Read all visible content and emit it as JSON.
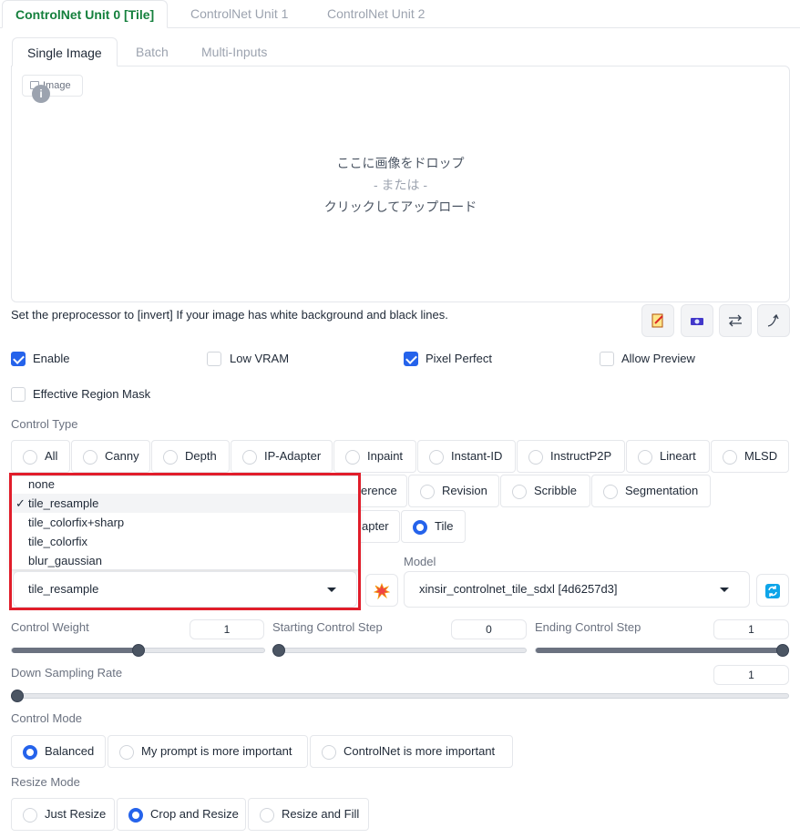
{
  "unit_tabs": [
    "ControlNet Unit 0 [Tile]",
    "ControlNet Unit 1",
    "ControlNet Unit 2"
  ],
  "sub_tabs": [
    "Single Image",
    "Batch",
    "Multi-Inputs"
  ],
  "image_label": "Image",
  "drop_text": {
    "line1": "ここに画像をドロップ",
    "line2": "- または -",
    "line3": "クリックしてアップロード"
  },
  "hint": "Set the preprocessor to [invert] If your image has white background and black lines.",
  "tool_icons": [
    "edit-icon",
    "camera-icon",
    "swap-icon",
    "curve-arrow-icon"
  ],
  "checkboxes": {
    "enable": {
      "label": "Enable",
      "checked": true
    },
    "low_vram": {
      "label": "Low VRAM",
      "checked": false
    },
    "pixel_perfect": {
      "label": "Pixel Perfect",
      "checked": true
    },
    "allow_preview": {
      "label": "Allow Preview",
      "checked": false
    },
    "effective_region_mask": {
      "label": "Effective Region Mask",
      "checked": false
    }
  },
  "control_type": {
    "label": "Control Type",
    "row1": [
      "All",
      "Canny",
      "Depth",
      "IP-Adapter",
      "Inpaint",
      "Instant-ID",
      "InstructP2P",
      "Lineart",
      "MLSD"
    ],
    "row2_visible": [
      "erence",
      "Revision",
      "Scribble",
      "Segmentation"
    ],
    "row3_visible": [
      "apter",
      "Tile"
    ],
    "selected": "Tile"
  },
  "preprocessor": {
    "options": [
      "none",
      "tile_resample",
      "tile_colorfix+sharp",
      "tile_colorfix",
      "blur_gaussian"
    ],
    "value": "tile_resample",
    "check_mark": "✓"
  },
  "model": {
    "label": "Model",
    "value": "xinsir_controlnet_tile_sdxl [4d6257d3]"
  },
  "sliders": {
    "control_weight": {
      "label": "Control Weight",
      "value": "1",
      "fraction": 0.5
    },
    "starting_step": {
      "label": "Starting Control Step",
      "value": "0",
      "fraction": 0.0
    },
    "ending_step": {
      "label": "Ending Control Step",
      "value": "1",
      "fraction": 1.0
    },
    "down_sampling": {
      "label": "Down Sampling Rate",
      "value": "1",
      "fraction": 0.0
    }
  },
  "control_mode": {
    "label": "Control Mode",
    "options": [
      "Balanced",
      "My prompt is more important",
      "ControlNet is more important"
    ],
    "selected": "Balanced"
  },
  "resize_mode": {
    "label": "Resize Mode",
    "options": [
      "Just Resize",
      "Crop and Resize",
      "Resize and Fill"
    ],
    "selected": "Crop and Resize"
  },
  "colors": {
    "accent": "#2563eb",
    "tab_active": "#15803d",
    "highlight_box": "#e11d2a"
  }
}
